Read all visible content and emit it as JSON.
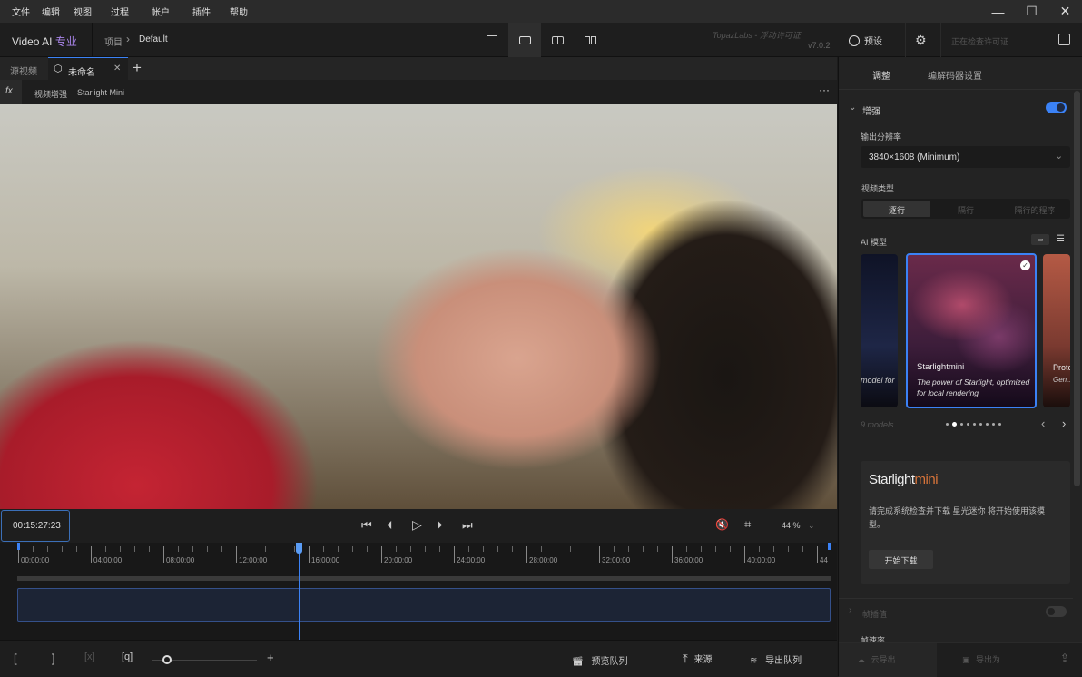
{
  "menu": [
    "文件",
    "编辑",
    "视图",
    "过程",
    "帐户",
    "插件",
    "帮助"
  ],
  "header": {
    "app": "Video AI",
    "edition": "专业",
    "crumb_root": "项目",
    "crumb_current": "Default",
    "license": "TopazLabs - 浮动许可证",
    "version": "v7.0.2",
    "preset": "预设",
    "license_status": "正在检查许可证..."
  },
  "tabs": {
    "source": "源视频",
    "active": "未命名"
  },
  "breadcrumb": {
    "fx": "fx",
    "step1": "视频增强",
    "step2": "Starlight Mini"
  },
  "controls": {
    "timecode": "00:15:27:23",
    "zoom": "44 %"
  },
  "timeline": {
    "labels": [
      "00:00:00",
      "04:00:00",
      "08:00:00",
      "12:00:00",
      "16:00:00",
      "20:00:00",
      "24:00:00",
      "28:00:00",
      "32:00:00",
      "36:00:00",
      "40:00:00",
      "44"
    ],
    "playhead_minutes": 15.46,
    "total_minutes": 44
  },
  "bottom": {
    "preview_queue": "预览队列",
    "source": "来源",
    "export_queue": "导出队列"
  },
  "panel": {
    "tab_adjust": "调整",
    "tab_codec": "编解码器设置",
    "enhance": "增强",
    "enhance_on": true,
    "output_res_label": "输出分辨率",
    "output_res": "3840×1608 (Minimum)",
    "video_type_label": "视频类型",
    "video_types": [
      "逐行",
      "隔行",
      "隔行的程序"
    ],
    "ai_model_label": "AI 模型",
    "prev_card_desc": "model for",
    "card_title": "Starlightmini",
    "card_desc": "The power of Starlight, optimized for local rendering",
    "next_card_title": "Proteus",
    "next_card_desc": "Gen... mos...",
    "models_count": "9 models",
    "pages": 9,
    "active_page": 2,
    "promo_title": "Starlight",
    "promo_title_accent": "mini",
    "promo_text": "请完成系统检查并下载 星光迷你 将开始使用该模型。",
    "download": "开始下载",
    "frame_interp": "帧插值",
    "frame_interp_on": false,
    "frame_rate": "帧速率",
    "cloud_export": "云导出",
    "export_as": "导出为..."
  },
  "colors": {
    "accent": "#3b82f6",
    "edition": "#a884e8"
  }
}
